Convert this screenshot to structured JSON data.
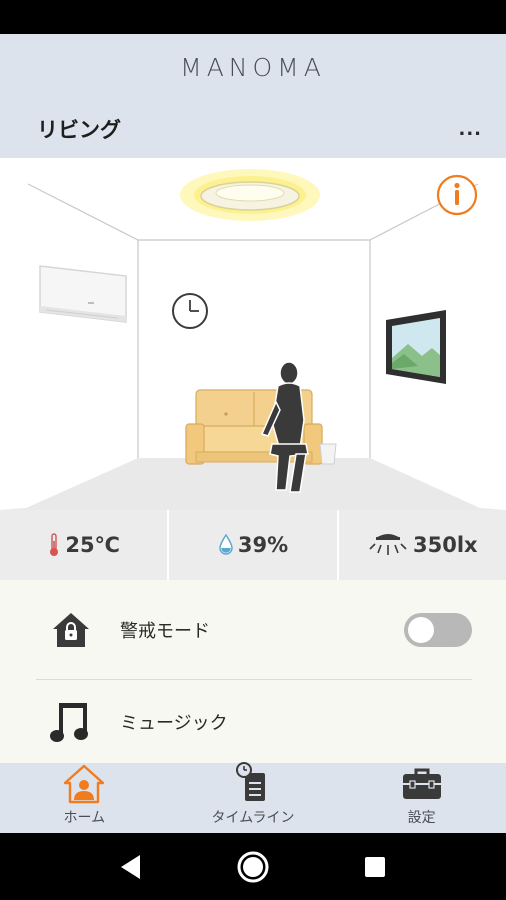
{
  "app": {
    "brand": "MANOMA"
  },
  "room": {
    "title": "リビング",
    "more_label": "..."
  },
  "sensors": {
    "temperature": "25℃",
    "humidity": "39%",
    "illuminance": "350lx"
  },
  "menu": {
    "security_label": "警戒モード",
    "security_enabled": false,
    "music_label": "ミュージック"
  },
  "tabs": [
    {
      "label": "ホーム",
      "icon": "home-person-icon",
      "active": true
    },
    {
      "label": "タイムライン",
      "icon": "timeline-icon",
      "active": false
    },
    {
      "label": "設定",
      "icon": "toolbox-icon",
      "active": false
    }
  ],
  "colors": {
    "accent": "#f07c1e",
    "header_bg": "#dde3ec",
    "sensor_bg": "#ececec",
    "menu_bg": "#f8f8f3",
    "toggle_off": "#b8b8b8"
  },
  "icons": {
    "info": "info-icon",
    "ceiling_light": "ceiling-light-icon",
    "air_conditioner": "air-conditioner-icon",
    "clock": "clock-icon",
    "tv": "tv-icon",
    "sofa": "sofa-icon",
    "person": "person-icon",
    "thermometer": "thermometer-icon",
    "droplet": "droplet-icon",
    "light_sensor": "light-sensor-icon",
    "lock_house": "security-house-icon",
    "music": "music-note-icon",
    "back": "back-icon",
    "home_nav": "home-nav-icon",
    "recents": "recents-icon"
  }
}
